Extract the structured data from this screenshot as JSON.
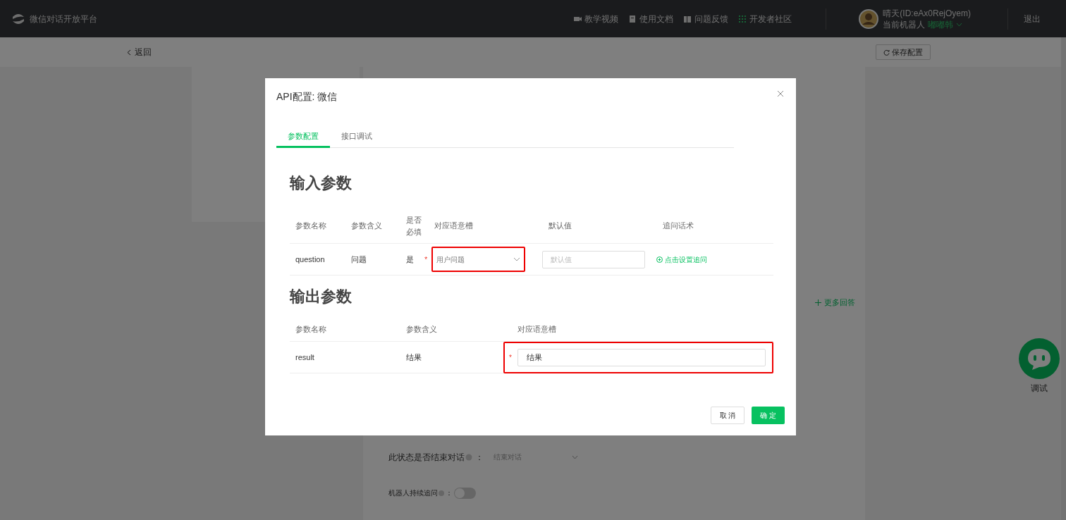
{
  "header": {
    "logo_text": "微信对话开放平台",
    "nav": [
      {
        "kind": "video",
        "label": "教学视频"
      },
      {
        "kind": "doc",
        "label": "使用文档"
      },
      {
        "kind": "feedback",
        "label": "问题反馈"
      },
      {
        "kind": "community",
        "label": "开发者社区"
      }
    ],
    "user": {
      "name": "晴天(ID:eAx0RejOyem)",
      "robot_label": "当前机器人",
      "robot_name": "嘟嘟韩"
    },
    "logout": "退出"
  },
  "subbar": {
    "back": "返回",
    "save": "保存配置"
  },
  "background": {
    "more_answers": "更多回答",
    "end_dialog_label": "此状态是否结束对话",
    "end_dialog_colon": "：",
    "end_dialog_value": "结束对话",
    "follow_up_label": "机器人持续追问",
    "follow_up_colon": "：",
    "follow_up_on": false,
    "debug_label": "调试"
  },
  "modal": {
    "title": "API配置: 微信",
    "tabs": [
      {
        "label": "参数配置",
        "selected": true
      },
      {
        "label": "接口调试",
        "selected": false
      }
    ],
    "input_section": {
      "title": "输入参数",
      "columns": [
        "参数名称",
        "参数含义",
        "是否必填",
        "对应语意槽",
        "默认值",
        "追问话术"
      ],
      "rows": [
        {
          "name": "question",
          "meaning": "问题",
          "required": "是",
          "required_mark": "*",
          "slot": "用户问题",
          "slot_highlighted": true,
          "default_placeholder": "默认值",
          "followup_link": "点击设置追问"
        }
      ]
    },
    "output_section": {
      "title": "输出参数",
      "columns": [
        "参数名称",
        "参数含义",
        "对应语意槽"
      ],
      "rows": [
        {
          "name": "result",
          "meaning": "结果",
          "required_mark": "*",
          "slot": "结果",
          "slot_highlighted": true
        }
      ]
    },
    "buttons": {
      "cancel": "取 消",
      "ok": "确 定"
    }
  }
}
